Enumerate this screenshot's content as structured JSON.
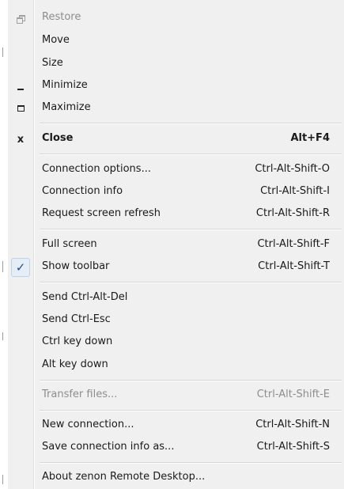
{
  "menu": {
    "window_items": [
      {
        "label": "Restore",
        "icon": "restore-icon",
        "enabled": false
      },
      {
        "label": "Move",
        "icon": "",
        "enabled": true
      },
      {
        "label": "Size",
        "icon": "",
        "enabled": true
      },
      {
        "label": "Minimize",
        "icon": "minimize-icon",
        "enabled": true
      },
      {
        "label": "Maximize",
        "icon": "maximize-icon",
        "enabled": true
      }
    ],
    "close": {
      "label": "Close",
      "icon": "x",
      "shortcut": "Alt+F4"
    },
    "connection_items": [
      {
        "label": "Connection options...",
        "shortcut": "Ctrl-Alt-Shift-O"
      },
      {
        "label": "Connection info",
        "shortcut": "Ctrl-Alt-Shift-I"
      },
      {
        "label": "Request screen refresh",
        "shortcut": "Ctrl-Alt-Shift-R"
      }
    ],
    "view_items": [
      {
        "label": "Full screen",
        "shortcut": "Ctrl-Alt-Shift-F",
        "checked": false
      },
      {
        "label": "Show toolbar",
        "shortcut": "Ctrl-Alt-Shift-T",
        "checked": true,
        "check_glyph": "✓"
      }
    ],
    "key_items": [
      {
        "label": "Send Ctrl-Alt-Del"
      },
      {
        "label": "Send Ctrl-Esc"
      },
      {
        "label": "Ctrl key down"
      },
      {
        "label": "Alt key down"
      }
    ],
    "transfer": {
      "label": "Transfer files...",
      "shortcut": "Ctrl-Alt-Shift-E",
      "enabled": false
    },
    "session_items": [
      {
        "label": "New connection...",
        "shortcut": "Ctrl-Alt-Shift-N"
      },
      {
        "label": "Save connection info as...",
        "shortcut": "Ctrl-Alt-Shift-S"
      }
    ],
    "about": {
      "label": "About zenon Remote Desktop..."
    }
  },
  "colors": {
    "menu_bg": "#f0f0f0",
    "disabled_text": "#8d8d8d",
    "check_highlight": "#e5eef7",
    "check_mark": "#1a4f8b"
  }
}
